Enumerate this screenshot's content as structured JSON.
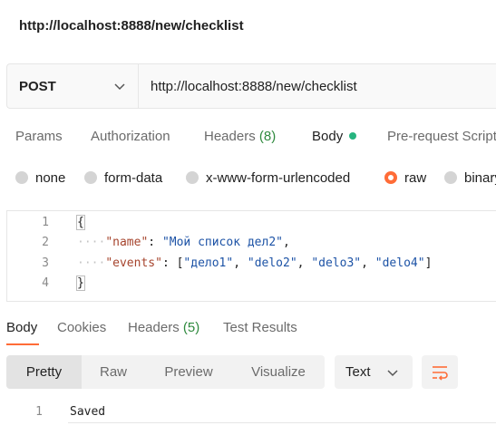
{
  "request": {
    "title": "http://localhost:8888/new/checklist",
    "method": "POST",
    "url": "http://localhost:8888/new/checklist"
  },
  "request_tabs": {
    "params": "Params",
    "authorization": "Authorization",
    "headers_label": "Headers",
    "headers_count": "(8)",
    "body": "Body",
    "prerequest": "Pre-request Script"
  },
  "body_types": {
    "none": "none",
    "form_data": "form-data",
    "urlencoded": "x-www-form-urlencoded",
    "raw": "raw",
    "binary": "binary",
    "selected": "raw"
  },
  "editor": {
    "line_numbers": [
      "1",
      "2",
      "3",
      "4"
    ],
    "open_brace": "{",
    "close_brace": "}",
    "name_key": "\"name\"",
    "name_value": "\"Мой список дел2\"",
    "events_key": "\"events\"",
    "events_values": [
      "\"дело1\"",
      "\"delo2\"",
      "\"delo3\"",
      "\"delo4\""
    ]
  },
  "response_tabs": {
    "body": "Body",
    "cookies": "Cookies",
    "headers_label": "Headers",
    "headers_count": "(5)",
    "test_results": "Test Results"
  },
  "view_modes": {
    "pretty": "Pretty",
    "raw": "Raw",
    "preview": "Preview",
    "visualize": "Visualize",
    "selected": "Pretty"
  },
  "format": "Text",
  "response": {
    "line_number": "1",
    "text": "Saved"
  },
  "colors": {
    "accent": "#ff6c37",
    "active_dot": "#26b47f",
    "count_green": "#2f8a3e",
    "json_key": "#a6442d",
    "json_string": "#1d53a6"
  },
  "icons": {
    "method_dropdown": "chevron-down-icon",
    "format_dropdown": "chevron-down-icon",
    "wrap": "wrap-lines-icon"
  }
}
